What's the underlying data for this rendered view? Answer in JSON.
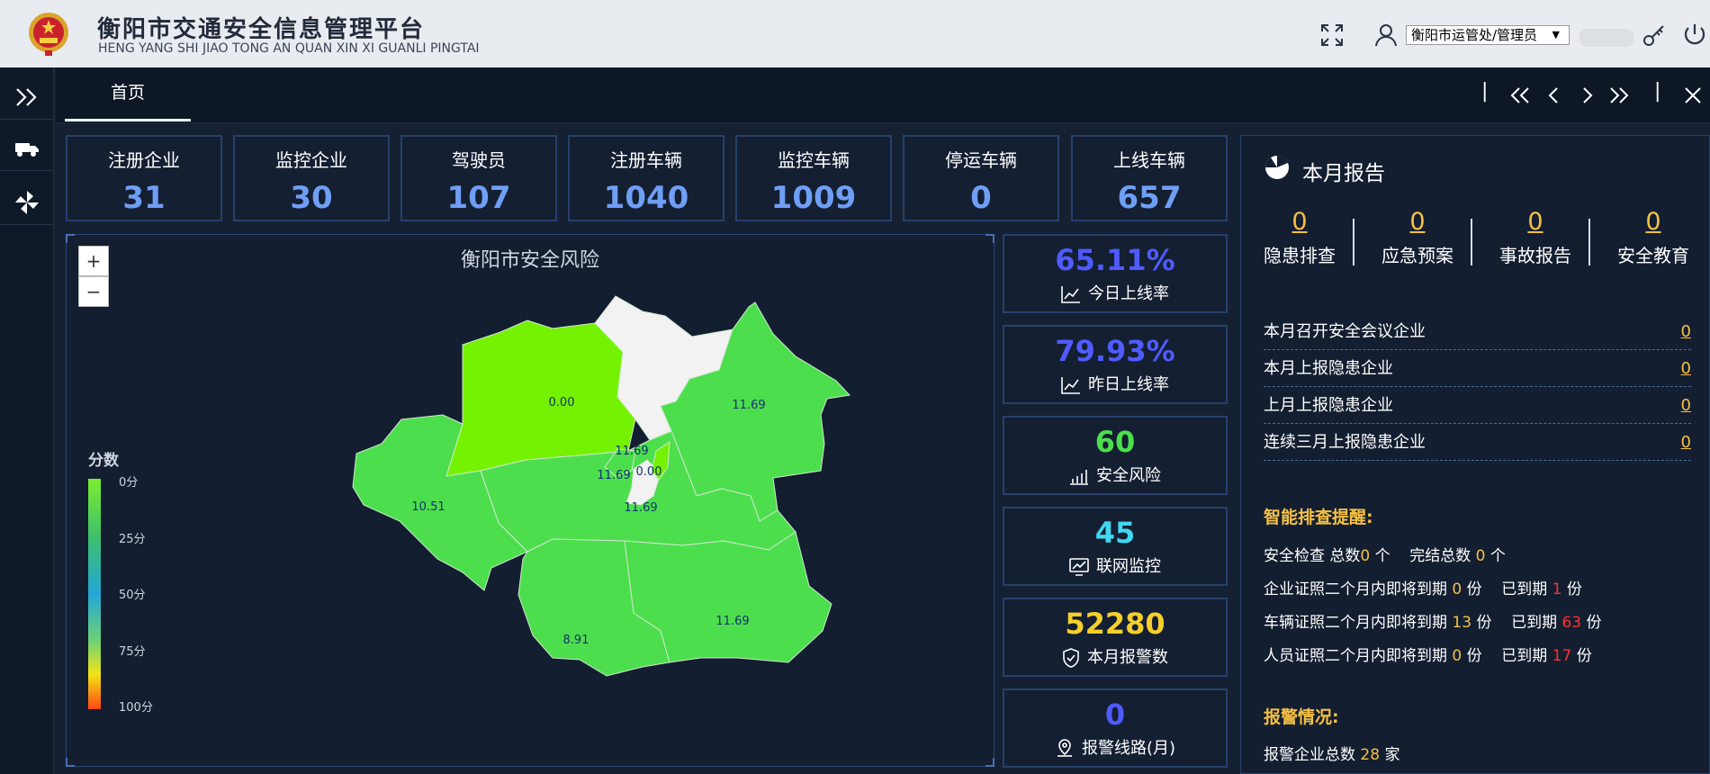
{
  "header": {
    "title": "衡阳市交通安全信息管理平台",
    "subtitle": "HENG YANG SHI JIAO TONG AN QUAN XIN XI GUANLI PINGTAI",
    "user_select": "衡阳市运管处/管理员"
  },
  "tabs": {
    "home": "首页",
    "divider": "|"
  },
  "stats": [
    {
      "label": "注册企业",
      "value": "31"
    },
    {
      "label": "监控企业",
      "value": "30"
    },
    {
      "label": "驾驶员",
      "value": "107"
    },
    {
      "label": "注册车辆",
      "value": "1040"
    },
    {
      "label": "监控车辆",
      "value": "1009"
    },
    {
      "label": "停运车辆",
      "value": "0"
    },
    {
      "label": "上线车辆",
      "value": "657"
    }
  ],
  "map": {
    "title": "衡阳市安全风险",
    "zoom_in": "+",
    "zoom_out": "−",
    "legend_title": "分数",
    "legend_labels": [
      "0分",
      "25分",
      "50分",
      "75分",
      "100分"
    ],
    "region_values": [
      "0.00",
      "11.69",
      "11.69",
      "11.69",
      "0.00",
      "10.51",
      "11.69",
      "8.91",
      "11.69"
    ]
  },
  "metrics": [
    {
      "value": "65.11%",
      "label": "今日上线率",
      "color": "#4f5bff"
    },
    {
      "value": "79.93%",
      "label": "昨日上线率",
      "color": "#4f5bff"
    },
    {
      "value": "60",
      "label": "安全风险",
      "color": "#4be04b"
    },
    {
      "value": "45",
      "label": "联网监控",
      "color": "#3fd8f2"
    },
    {
      "value": "52280",
      "label": "本月报警数",
      "color": "#f5d02a"
    },
    {
      "value": "0",
      "label": "报警线路(月)",
      "color": "#4f5bff"
    }
  ],
  "report": {
    "title": "本月报告",
    "columns": [
      {
        "num": "0",
        "label": "隐患排查"
      },
      {
        "num": "0",
        "label": "应急预案"
      },
      {
        "num": "0",
        "label": "事故报告"
      },
      {
        "num": "0",
        "label": "安全教育"
      }
    ],
    "rows": [
      {
        "label": "本月召开安全会议企业",
        "value": "0"
      },
      {
        "label": "本月上报隐患企业",
        "value": "0"
      },
      {
        "label": "上月上报隐患企业",
        "value": "0"
      },
      {
        "label": "连续三月上报隐患企业",
        "value": "0"
      }
    ],
    "smart_title": "智能排查提醒:",
    "check": {
      "a": "安全检查 总数",
      "n1": "0",
      "b": "个",
      "c": "完结总数",
      "n2": "0",
      "d": "个"
    },
    "expiry": [
      {
        "label": "企业证照二个月内即将到期",
        "soon": "0",
        "unit": "份",
        "expired_label": "已到期",
        "expired": "1"
      },
      {
        "label": "车辆证照二个月内即将到期",
        "soon": "13",
        "unit": "份",
        "expired_label": "已到期",
        "expired": "63"
      },
      {
        "label": "人员证照二个月内即将到期",
        "soon": "0",
        "unit": "份",
        "expired_label": "已到期",
        "expired": "17"
      }
    ],
    "alarm_title": "报警情况:",
    "alarm": {
      "label": "报警企业总数",
      "value": "28",
      "unit": "家"
    }
  }
}
